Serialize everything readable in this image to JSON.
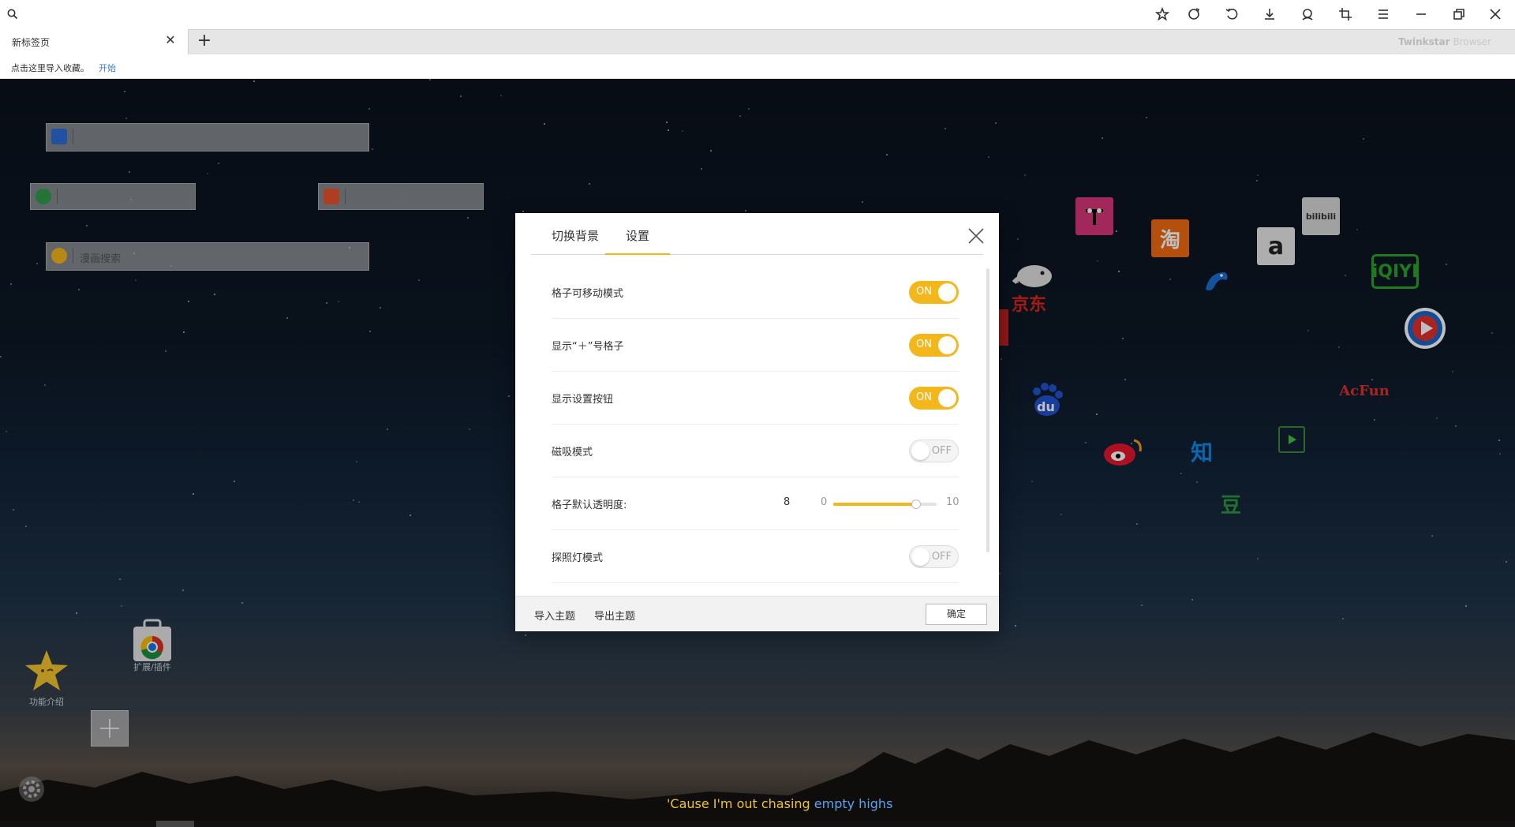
{
  "toolbar": {
    "icons": [
      "search-icon",
      "star-icon",
      "refresh-icon",
      "undo-icon",
      "download-icon",
      "user-icon",
      "crop-icon",
      "menu-icon",
      "minimize-icon",
      "restore-icon",
      "close-icon"
    ]
  },
  "tabs": {
    "active_title": "新标签页",
    "close_glyph": "✕",
    "new_tab_glyph": "+",
    "brand_bold": "Twinkstar",
    "brand_rest": " Browser"
  },
  "bookmarks": {
    "tip": "点击这里导入收藏。",
    "start": "开始"
  },
  "search_boxes": {
    "manga_placeholder": "漫画搜索"
  },
  "sites": {
    "jd": "京东",
    "taobao": "淘",
    "amazon": "a",
    "bilibili": "bilibili",
    "iqiyi": "iQIYI",
    "acfun": "AcFun",
    "baidu": "du",
    "zhihu": "知",
    "douban": "豆"
  },
  "widgets": {
    "extensions": "扩展/插件",
    "intro": "功能介绍"
  },
  "dialog": {
    "tab_background": "切换背景",
    "tab_settings": "设置",
    "rows": [
      {
        "label": "格子可移动模式",
        "state": "ON"
      },
      {
        "label": "显示“＋”号格子",
        "state": "ON"
      },
      {
        "label": "显示设置按钮",
        "state": "ON"
      },
      {
        "label": "磁吸模式",
        "state": "OFF"
      },
      {
        "label": "探照灯模式",
        "state": "OFF"
      }
    ],
    "opacity": {
      "label": "格子默认透明度:",
      "value": "8",
      "min": "0",
      "max": "10",
      "fraction": 0.8
    },
    "import_theme": "导入主题",
    "export_theme": "导出主题",
    "ok": "确定"
  },
  "lyric": {
    "part1": "'Cause I'm out chasing ",
    "part2": "empty highs"
  },
  "colors": {
    "accent": "#f4b71b",
    "link": "#3a7bd5"
  }
}
